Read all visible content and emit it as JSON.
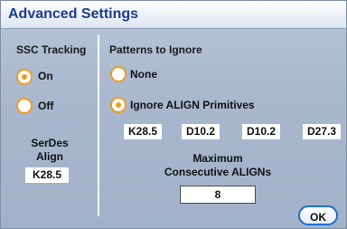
{
  "window": {
    "title": "Advanced Settings"
  },
  "ssc": {
    "heading": "SSC Tracking",
    "options": [
      {
        "label": "On",
        "selected": true
      },
      {
        "label": "Off",
        "selected": false
      }
    ],
    "serdes_label_line1": "SerDes",
    "serdes_label_line2": "Align",
    "serdes_value": "K28.5"
  },
  "patterns": {
    "heading": "Patterns to Ignore",
    "options": [
      {
        "label": "None",
        "selected": false
      },
      {
        "label": "Ignore ALIGN Primitives",
        "selected": true
      }
    ],
    "primitives": [
      "K28.5",
      "D10.2",
      "D10.2",
      "D27.3"
    ],
    "max_label_line1": "Maximum",
    "max_label_line2": "Consecutive ALIGNs",
    "max_value": "8"
  },
  "buttons": {
    "ok": "OK"
  },
  "colors": {
    "accent": "#f39a1f",
    "title": "#1b3d8f",
    "ok_border": "#1b6fd3"
  }
}
